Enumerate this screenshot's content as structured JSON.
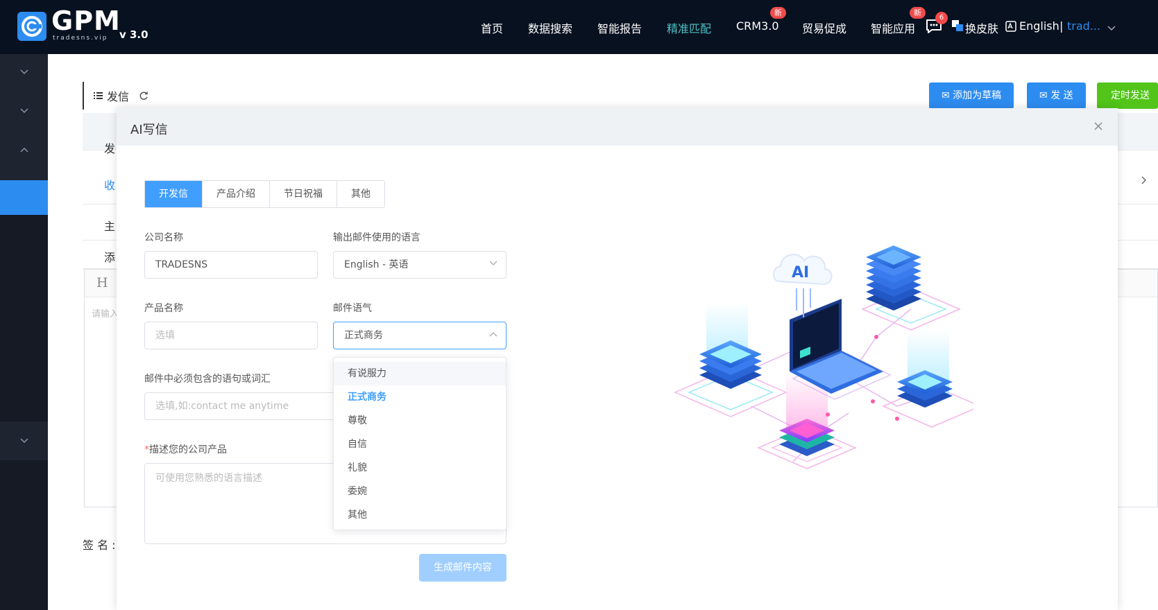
{
  "header": {
    "logo_text": "GPM",
    "logo_sub": "tradesns.vip",
    "version": "v 3.0",
    "nav": [
      {
        "label": "首页",
        "active": false
      },
      {
        "label": "数据搜索",
        "active": false
      },
      {
        "label": "智能报告",
        "active": false
      },
      {
        "label": "精准匹配",
        "active": true
      },
      {
        "label": "CRM3.0",
        "active": false,
        "badge": "新"
      },
      {
        "label": "贸易促成",
        "active": false
      },
      {
        "label": "智能应用",
        "active": false,
        "badge": "新"
      }
    ],
    "message_count": "6",
    "skin_label": "换皮肤",
    "language_label": "English",
    "separator": "|",
    "user_name": "trad..."
  },
  "page": {
    "title": "发信",
    "buttons": {
      "add_draft": "添加为草稿",
      "send": "发 送",
      "scheduled": "定时发送"
    },
    "rows": {
      "sender_partial": "发",
      "recipient_partial": "收",
      "subject_partial": "主",
      "attachment_partial": "添"
    },
    "editor_heading": "H",
    "editor_placeholder_partial": "请输入",
    "signature_label": "签 名 :"
  },
  "dialog": {
    "title": "AI写信",
    "tabs": [
      {
        "label": "开发信",
        "active": true
      },
      {
        "label": "产品介绍",
        "active": false
      },
      {
        "label": "节日祝福",
        "active": false
      },
      {
        "label": "其他",
        "active": false
      }
    ],
    "fields": {
      "company_name": {
        "label": "公司名称",
        "value": "TRADESNS"
      },
      "output_language": {
        "label": "输出邮件使用的语言",
        "value": "English - 英语"
      },
      "product_name": {
        "label": "产品名称",
        "placeholder": "选填"
      },
      "tone": {
        "label": "邮件语气",
        "value": "正式商务"
      },
      "must_include": {
        "label": "邮件中必须包含的语句或词汇",
        "placeholder": "选填,如:contact me anytime"
      },
      "describe": {
        "required_mark": "*",
        "label": "描述您的公司产品",
        "placeholder": "可使用您熟悉的语言描述"
      }
    },
    "tone_options": [
      {
        "label": "有说服力",
        "state": "hover"
      },
      {
        "label": "正式商务",
        "state": "selected"
      },
      {
        "label": "尊敬",
        "state": ""
      },
      {
        "label": "自信",
        "state": ""
      },
      {
        "label": "礼貌",
        "state": ""
      },
      {
        "label": "委婉",
        "state": ""
      },
      {
        "label": "其他",
        "state": ""
      }
    ],
    "generate_button": "生成邮件内容",
    "illustration_text": "AI"
  },
  "colors": {
    "topbar": "#08111f",
    "primary": "#409eff",
    "active_nav": "#4ec3c7",
    "badge": "#f04b4b",
    "green": "#52c41a",
    "sidebar": "#151a24"
  }
}
